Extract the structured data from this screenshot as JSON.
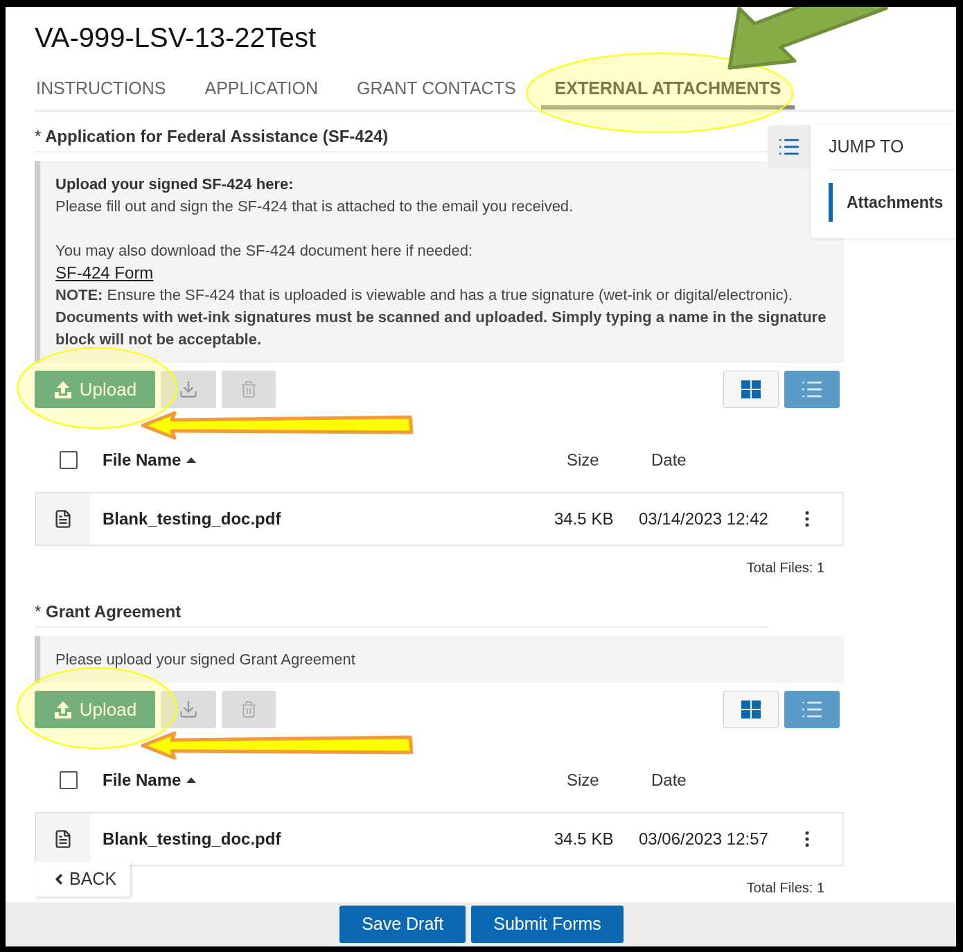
{
  "title": "VA-999-LSV-13-22Test",
  "tabs": [
    {
      "label": "INSTRUCTIONS",
      "selected": false,
      "highlight": false
    },
    {
      "label": "APPLICATION",
      "selected": false,
      "highlight": false
    },
    {
      "label": "GRANT CONTACTS",
      "selected": false,
      "highlight": false
    },
    {
      "label": "EXTERNAL ATTACHMENTS",
      "selected": true,
      "highlight": true,
      "arrow": true
    }
  ],
  "jump_to": {
    "heading": "JUMP TO",
    "items": [
      {
        "label": "Attachments",
        "selected": true
      }
    ]
  },
  "sections": [
    {
      "required_mark": "*",
      "title": "Application for Federal Assistance (SF-424)",
      "info": [
        {
          "kind": "title",
          "text": "Upload your signed SF-424 here:"
        },
        {
          "kind": "text",
          "text": "Please fill out and sign the SF-424 that is attached to the email you received."
        },
        {
          "kind": "spaced",
          "text": "You may also download the SF-424 document here if needed:"
        },
        {
          "kind": "link",
          "text": "SF-424 Form"
        },
        {
          "kind": "text",
          "text": "**NOTE:** Ensure the SF-424 that is uploaded is viewable and has a true signature (wet-ink or digital/electronic). **Documents with wet-ink signatures must be scanned and uploaded. Simply typing a name in the signature block will not be acceptable.**"
        }
      ],
      "upload_label": "Upload",
      "upload_highlight": true,
      "arrow": true,
      "view_modes": [
        {
          "kind": "grid",
          "selected": false
        },
        {
          "kind": "list",
          "selected": true
        }
      ],
      "columns": [
        {
          "label": "File Name",
          "sorted": true
        },
        {
          "label": "Size",
          "sorted": false
        },
        {
          "label": "Date",
          "sorted": false
        }
      ],
      "select_all": false,
      "rows": [
        {
          "name": "Blank_testing_doc.pdf",
          "size": "34.5 KB",
          "date": "03/14/2023 12:42"
        }
      ],
      "total": "Total Files: 1"
    },
    {
      "required_mark": "*",
      "title": "Grant Agreement",
      "info": [
        {
          "kind": "text",
          "text": "Please upload your signed Grant Agreement"
        }
      ],
      "upload_label": "Upload",
      "upload_highlight": true,
      "arrow": true,
      "view_modes": [
        {
          "kind": "grid",
          "selected": false
        },
        {
          "kind": "list",
          "selected": true
        }
      ],
      "columns": [
        {
          "label": "File Name",
          "sorted": true
        },
        {
          "label": "Size",
          "sorted": false
        },
        {
          "label": "Date",
          "sorted": false
        }
      ],
      "select_all": false,
      "rows": [
        {
          "name": "Blank_testing_doc.pdf",
          "size": "34.5 KB",
          "date": "03/06/2023 12:57"
        }
      ],
      "total": "Total Files: 1"
    }
  ],
  "back": "BACK",
  "footer_buttons": [
    "Save Draft",
    "Submit Forms"
  ]
}
